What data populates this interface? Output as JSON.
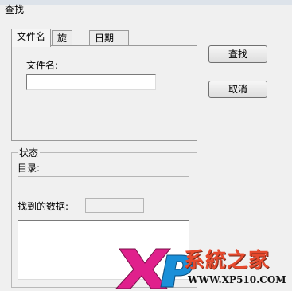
{
  "window": {
    "title": "查找"
  },
  "tabs": [
    {
      "label": "文件名",
      "active": true
    },
    {
      "label": "旋",
      "active": false
    },
    {
      "label": "日期",
      "active": false
    }
  ],
  "filename_tab": {
    "label": "文件名:",
    "value": ""
  },
  "buttons": {
    "find": "查找",
    "cancel": "取消"
  },
  "status": {
    "group_label": "状态",
    "dir_label": "目录:",
    "dir_value": "",
    "found_label": "找到的数据:",
    "found_value": ""
  },
  "watermark": {
    "brand_text": "系統之家",
    "brand_latin": "XP",
    "site": "WWW.XP510.COM",
    "colors": {
      "x": "#e0208c",
      "p": "#1a8fd8",
      "brand": "#e64a2e"
    }
  }
}
